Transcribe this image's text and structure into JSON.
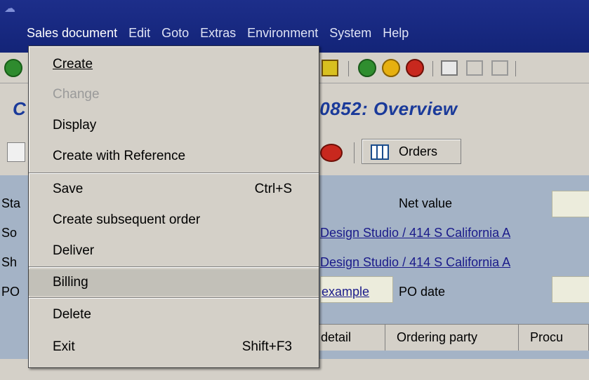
{
  "menubar": {
    "items": [
      {
        "label": "Sales document",
        "u": "S"
      },
      {
        "label": "Edit"
      },
      {
        "label": "Goto"
      },
      {
        "label": "Extras"
      },
      {
        "label": "Environment"
      },
      {
        "label": "System"
      },
      {
        "label": "Help"
      }
    ]
  },
  "page": {
    "title_left": "C",
    "title_right": "0852: Overview"
  },
  "toolbar2": {
    "orders_label": "Orders"
  },
  "form": {
    "stub_labels": [
      "Sta",
      "So",
      "Sh",
      "PO"
    ],
    "net_value_label": "Net value",
    "sold_to_link": "Design Studio / 414 S California A",
    "ship_to_link": "Design Studio / 414 S California A",
    "po_link": "example",
    "po_date_label": "PO date"
  },
  "tabs": [
    "detail",
    "Ordering party",
    "Procu"
  ],
  "dropdown": {
    "create": "Create",
    "change": "Change",
    "display": "Display",
    "create_with_reference": "Create with Reference",
    "save": "Save",
    "save_shortcut": "Ctrl+S",
    "create_subsequent_order": "Create subsequent order",
    "deliver": "Deliver",
    "billing": "Billing",
    "delete": "Delete",
    "exit": "Exit",
    "exit_shortcut": "Shift+F3"
  },
  "colors": {
    "title_bar": "#132478",
    "page_title": "#1a3a9a",
    "form_background": "#a4b3c6",
    "menu_selected": "#c2c0b8"
  }
}
